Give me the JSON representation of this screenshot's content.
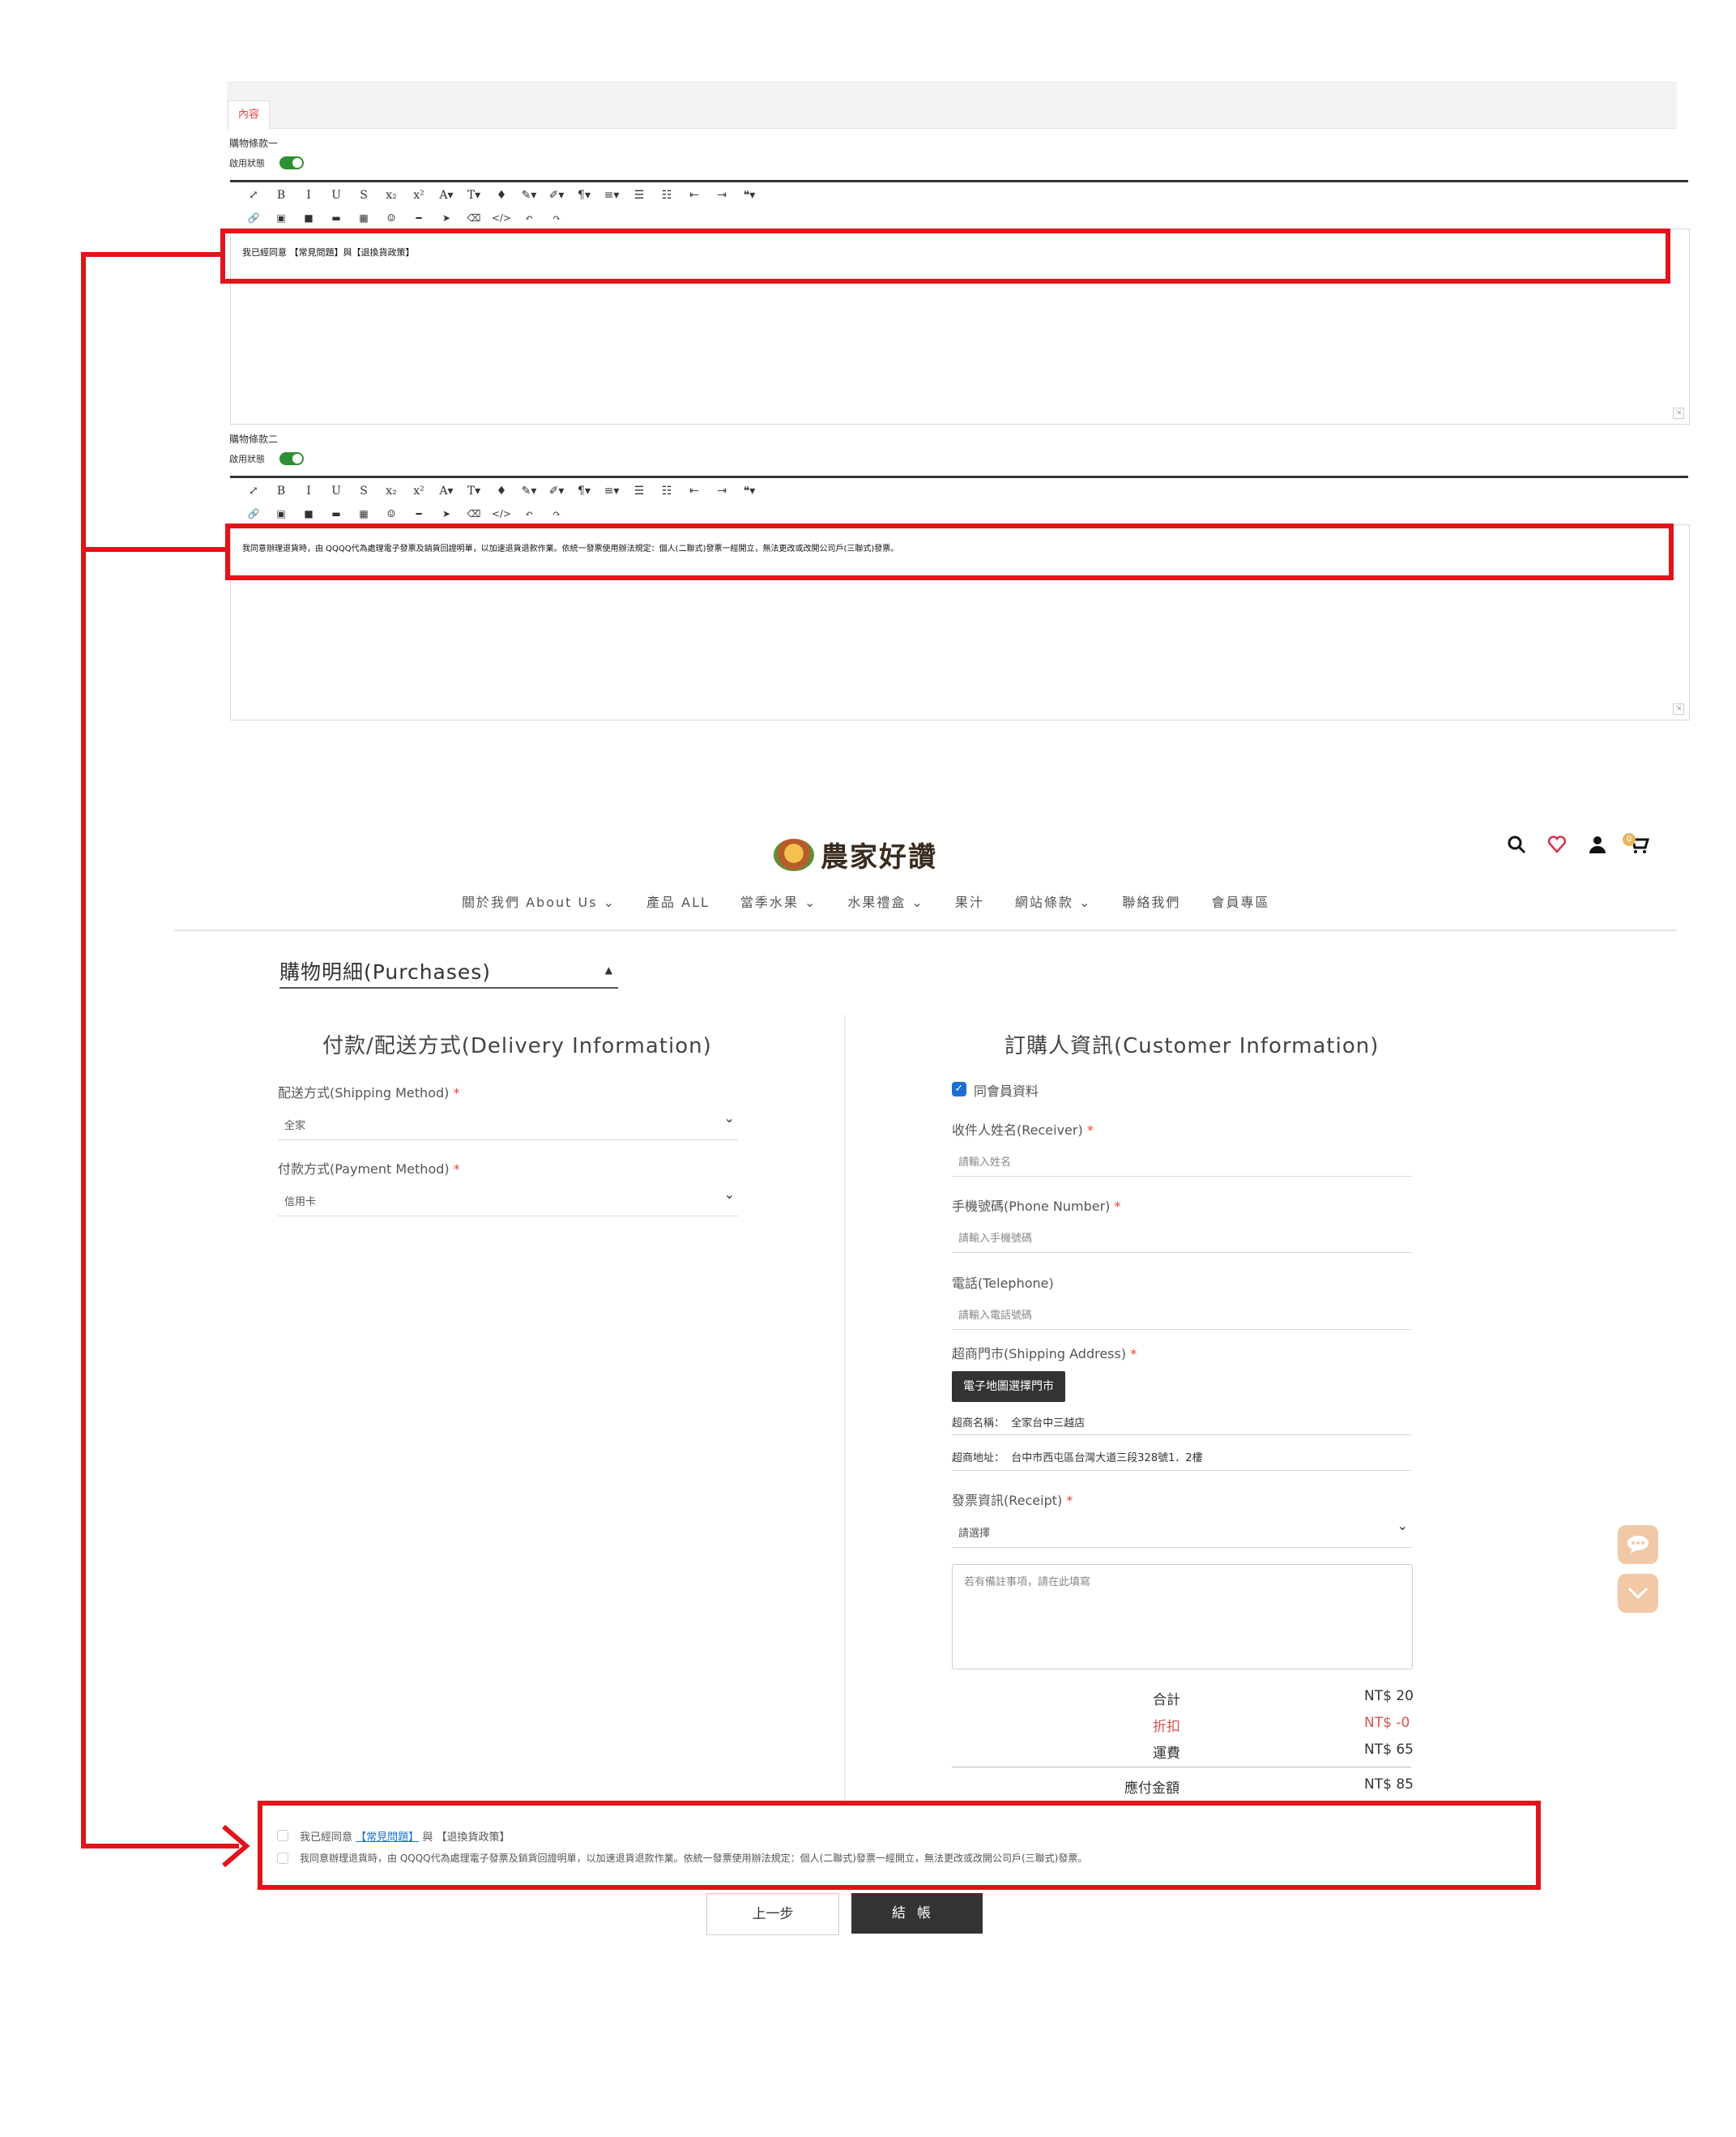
{
  "admin": {
    "tab_label": "內容",
    "toolbar_row1": [
      "⤢",
      "B",
      "I",
      "U",
      "S",
      "x₂",
      "x²",
      "A▾",
      "T▾",
      "♦",
      "✎▾",
      "✐▾",
      "¶▾",
      "≡▾",
      "☰",
      "☷",
      "⇤",
      "⇥",
      "❝▾"
    ],
    "toolbar_row2": [
      "🔗",
      "▣",
      "■",
      "▬",
      "▦",
      "☺",
      "━",
      "➤",
      "⌫",
      "</>",
      "↶",
      "↷"
    ],
    "clause1": {
      "title": "購物條款一",
      "status_label": "啟用狀態",
      "text": "我已經同意 【常見問題】與【退換貨政策】"
    },
    "clause2": {
      "title": "購物條款二",
      "status_label": "啟用狀態",
      "text": "我同意辦理退貨時，由 QQQQ代為處理電子發票及銷貨回證明單，以加速退貨退款作業。依統一發票使用辦法規定：個人(二聯式)發票一經開立，無法更改或改開公司戶(三聯式)發票。"
    },
    "grip": "⇲"
  },
  "store": {
    "brand_name": "農家好讚",
    "icons": {
      "search": "search-icon",
      "heart": "heart-icon",
      "user": "user-icon",
      "cart": "cart-icon"
    },
    "cart_count": "0",
    "nav": [
      "關於我們 About Us ⌄",
      "產品 ALL",
      "當季水果 ⌄",
      "水果禮盒 ⌄",
      "果汁",
      "網站條款 ⌄",
      "聯絡我們",
      "會員專區"
    ],
    "purchases_label": "購物明細(Purchases)",
    "purchases_arrow": "▲",
    "delivery": {
      "title": "付款/配送方式(Delivery Information)",
      "shipping_label": "配送方式(Shipping Method)",
      "shipping_value": "全家",
      "payment_label": "付款方式(Payment Method)",
      "payment_value": "信用卡",
      "required": "*",
      "chevron": "⌄"
    },
    "customer": {
      "title": "訂購人資訊(Customer Information)",
      "same_as_member": "同會員資料",
      "receiver_label": "收件人姓名(Receiver)",
      "receiver_placeholder": "請輸入姓名",
      "phone_label": "手機號碼(Phone Number)",
      "phone_placeholder": "請輸入手機號碼",
      "tel_label": "電話(Telephone)",
      "tel_placeholder": "請輸入電話號碼",
      "address_label": "超商門市(Shipping Address)",
      "map_button": "電子地圖選擇門市",
      "store_name_label": "超商名稱：",
      "store_name_value": "全家台中三越店",
      "store_addr_label": "超商地址：",
      "store_addr_value": "台中市西屯區台灣大道三段328號1．2樓",
      "receipt_label": "發票資訊(Receipt)",
      "receipt_value": "請選擇",
      "note_placeholder": "若有備註事項，請在此填寫"
    },
    "summary": {
      "subtotal_label": "合計",
      "subtotal_value": "NT$ 20",
      "discount_label": "折扣",
      "discount_value": "NT$ -0",
      "shipping_label": "運費",
      "shipping_value": "NT$ 65",
      "total_label": "應付金額",
      "total_value": "NT$ 85"
    },
    "terms": {
      "line1_prefix": "我已經同意",
      "line1_link": "【常見問題】",
      "line1_mid": "與",
      "line1_suffix": "【退換貨政策】",
      "line2": "我同意辦理退貨時，由 QQQQ代為處理電子發票及銷貨回證明單，以加速退貨退款作業。依統一發票使用辦法規定：個人(二聯式)發票一經開立，無法更改或改開公司戶(三聯式)發票。"
    },
    "buttons": {
      "prev": "上一步",
      "checkout": "結帳"
    },
    "float": {
      "chat": "chat-icon",
      "scroll": "chevron-down-icon"
    }
  },
  "colors": {
    "annotation_red": "#e3131b",
    "toggle_green": "#2f8f34",
    "accent_blue": "#1c6fd1",
    "dark_button": "#333333"
  }
}
